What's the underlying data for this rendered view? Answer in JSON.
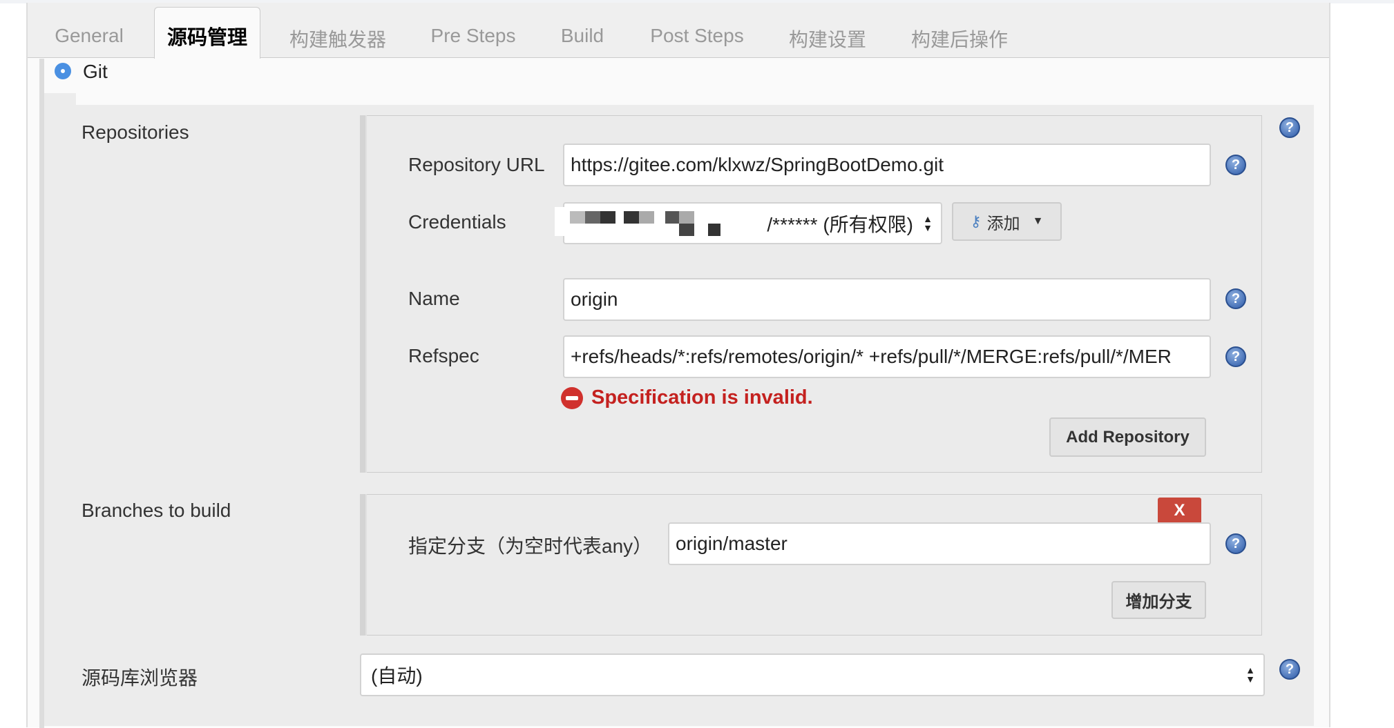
{
  "tabs": [
    {
      "label": "General",
      "active": false
    },
    {
      "label": "源码管理",
      "active": true
    },
    {
      "label": "构建触发器",
      "active": false
    },
    {
      "label": "Pre Steps",
      "active": false
    },
    {
      "label": "Build",
      "active": false
    },
    {
      "label": "Post Steps",
      "active": false
    },
    {
      "label": "构建设置",
      "active": false
    },
    {
      "label": "构建后操作",
      "active": false
    }
  ],
  "scm": {
    "option": "Git",
    "selected": true
  },
  "repositories": {
    "label": "Repositories",
    "url_label": "Repository URL",
    "url_value": "https://gitee.com/klxwz/SpringBootDemo.git",
    "credentials_label": "Credentials",
    "credentials_value": "/****** (所有权限)",
    "add_label": "添加",
    "name_label": "Name",
    "name_value": "origin",
    "refspec_label": "Refspec",
    "refspec_value": "+refs/heads/*:refs/remotes/origin/* +refs/pull/*/MERGE:refs/pull/*/MER",
    "error": "Specification is invalid.",
    "add_repository": "Add Repository"
  },
  "branches": {
    "label": "Branches to build",
    "delete_label": "X",
    "branch_label": "指定分支（为空时代表any）",
    "branch_value": "origin/master",
    "add_branch": "增加分支"
  },
  "browser": {
    "label": "源码库浏览器",
    "value": "(自动)"
  },
  "help_glyph": "?",
  "colors": {
    "error": "#c4211f",
    "radio": "#4a90e2",
    "delete": "#c9483b"
  }
}
